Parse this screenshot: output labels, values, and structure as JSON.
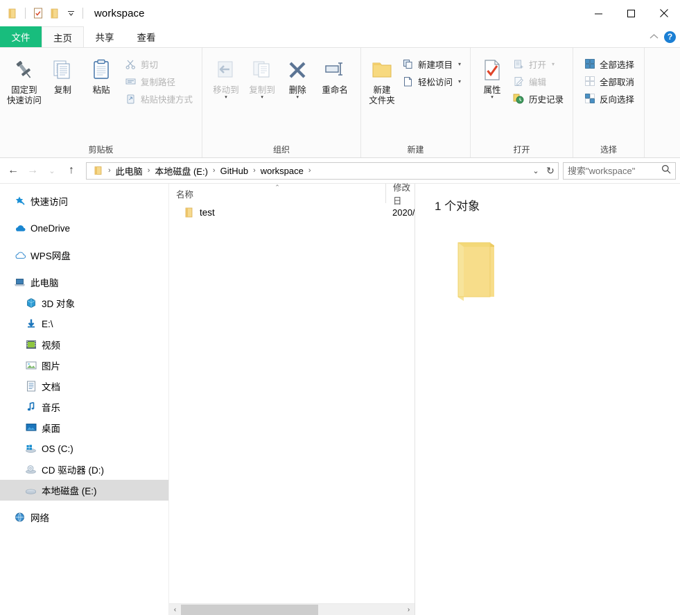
{
  "titlebar": {
    "title": "workspace",
    "qat": [
      {
        "name": "folder-icon",
        "label": "folder"
      },
      {
        "name": "properties-icon",
        "label": "属性"
      },
      {
        "name": "new-folder-icon",
        "label": "新建文件夹"
      }
    ],
    "customize_caret": "▾",
    "minimize": "—",
    "maximize": "▢",
    "close": "✕"
  },
  "tabs": [
    {
      "id": "file",
      "label": "文件"
    },
    {
      "id": "home",
      "label": "主页"
    },
    {
      "id": "share",
      "label": "共享"
    },
    {
      "id": "view",
      "label": "查看"
    }
  ],
  "tabbar_right": {
    "collapse_caret": "⌃",
    "help": "?"
  },
  "ribbon": {
    "groups": [
      {
        "id": "clipboard",
        "label": "剪贴板",
        "big": [
          {
            "name": "pin-to-quick-access-button",
            "label": "固定到\n快速访问",
            "icon": "pin-icon",
            "disabled": false
          },
          {
            "name": "copy-button",
            "label": "复制",
            "icon": "copy-icon",
            "disabled": false
          },
          {
            "name": "paste-button",
            "label": "粘贴",
            "icon": "paste-icon",
            "disabled": false
          }
        ],
        "small": [
          {
            "name": "cut-button",
            "label": "剪切",
            "icon": "scissors-icon",
            "disabled": true
          },
          {
            "name": "copy-path-button",
            "label": "复制路径",
            "icon": "copy-path-icon",
            "disabled": true
          },
          {
            "name": "paste-shortcut-button",
            "label": "粘贴快捷方式",
            "icon": "paste-shortcut-icon",
            "disabled": true
          }
        ]
      },
      {
        "id": "organize",
        "label": "组织",
        "big": [
          {
            "name": "move-to-button",
            "label": "移动到",
            "icon": "move-to-icon",
            "disabled": true,
            "caret": true
          },
          {
            "name": "copy-to-button",
            "label": "复制到",
            "icon": "copy-to-icon",
            "disabled": true,
            "caret": true
          },
          {
            "name": "delete-button",
            "label": "删除",
            "icon": "delete-x-icon",
            "disabled": false,
            "caret": true
          },
          {
            "name": "rename-button",
            "label": "重命名",
            "icon": "rename-icon",
            "disabled": false
          }
        ],
        "small": []
      },
      {
        "id": "new",
        "label": "新建",
        "big": [
          {
            "name": "new-folder-button",
            "label": "新建\n文件夹",
            "icon": "new-folder-icon",
            "disabled": false
          }
        ],
        "small": [
          {
            "name": "new-item-button",
            "label": "新建项目",
            "icon": "new-item-icon",
            "disabled": false,
            "caret": true
          },
          {
            "name": "easy-access-button",
            "label": "轻松访问",
            "icon": "easy-access-icon",
            "disabled": false,
            "caret": true
          }
        ]
      },
      {
        "id": "open",
        "label": "打开",
        "big": [
          {
            "name": "properties-button",
            "label": "属性",
            "icon": "properties-icon",
            "disabled": false,
            "caret": true
          }
        ],
        "small": [
          {
            "name": "open-button",
            "label": "打开",
            "icon": "open-icon",
            "disabled": true,
            "caret": true
          },
          {
            "name": "edit-button",
            "label": "编辑",
            "icon": "edit-icon",
            "disabled": true
          },
          {
            "name": "history-button",
            "label": "历史记录",
            "icon": "history-icon",
            "disabled": false
          }
        ]
      },
      {
        "id": "select",
        "label": "选择",
        "big": [],
        "small": [
          {
            "name": "select-all-button",
            "label": "全部选择",
            "icon": "select-all-icon",
            "disabled": false
          },
          {
            "name": "select-none-button",
            "label": "全部取消",
            "icon": "select-none-icon",
            "disabled": false
          },
          {
            "name": "invert-selection-button",
            "label": "反向选择",
            "icon": "invert-selection-icon",
            "disabled": false
          }
        ]
      }
    ]
  },
  "addressbar": {
    "back": "←",
    "forward": "→",
    "recent_caret": "⌄",
    "up": "↑",
    "crumbs": [
      "此电脑",
      "本地磁盘 (E:)",
      "GitHub",
      "workspace"
    ],
    "sep": "›",
    "history_caret": "⌄",
    "refresh": "↻",
    "search_placeholder": "搜索\"workspace\"",
    "search_value": ""
  },
  "sidebar": {
    "items": [
      {
        "label": "快速访问",
        "icon": "star-pin-icon",
        "indent": false,
        "selected": false,
        "gap_after": true
      },
      {
        "label": "OneDrive",
        "icon": "onedrive-cloud-icon",
        "indent": false,
        "selected": false,
        "gap_after": true
      },
      {
        "label": "WPS网盘",
        "icon": "wps-cloud-icon",
        "indent": false,
        "selected": false,
        "gap_after": true
      },
      {
        "label": "此电脑",
        "icon": "this-pc-icon",
        "indent": false,
        "selected": false,
        "gap_after": false
      },
      {
        "label": "3D 对象",
        "icon": "3d-objects-icon",
        "indent": true,
        "selected": false,
        "gap_after": false
      },
      {
        "label": "E:\\",
        "icon": "downloads-icon",
        "indent": true,
        "selected": false,
        "gap_after": false
      },
      {
        "label": "视频",
        "icon": "videos-icon",
        "indent": true,
        "selected": false,
        "gap_after": false
      },
      {
        "label": "图片",
        "icon": "pictures-icon",
        "indent": true,
        "selected": false,
        "gap_after": false
      },
      {
        "label": "文档",
        "icon": "documents-icon",
        "indent": true,
        "selected": false,
        "gap_after": false
      },
      {
        "label": "音乐",
        "icon": "music-icon",
        "indent": true,
        "selected": false,
        "gap_after": false
      },
      {
        "label": "桌面",
        "icon": "desktop-icon",
        "indent": true,
        "selected": false,
        "gap_after": false
      },
      {
        "label": "OS (C:)",
        "icon": "windows-drive-icon",
        "indent": true,
        "selected": false,
        "gap_after": false
      },
      {
        "label": "CD 驱动器 (D:)",
        "icon": "cd-drive-icon",
        "indent": true,
        "selected": false,
        "gap_after": false
      },
      {
        "label": "本地磁盘 (E:)",
        "icon": "hard-drive-icon",
        "indent": true,
        "selected": true,
        "gap_after": true
      },
      {
        "label": "网络",
        "icon": "network-icon",
        "indent": false,
        "selected": false,
        "gap_after": false
      }
    ]
  },
  "filelist": {
    "columns": [
      {
        "id": "name",
        "label": "名称",
        "sorted": true,
        "sort_caret": "⌃"
      },
      {
        "id": "date",
        "label": "修改日",
        "sorted": false,
        "sort_caret": ""
      }
    ],
    "rows": [
      {
        "name": "test",
        "date": "2020/",
        "icon": "folder-icon"
      }
    ],
    "hscroll": {
      "left_arrow": "‹",
      "right_arrow": "›"
    }
  },
  "preview": {
    "count_text": "1 个对象",
    "icon": "large-folder-icon"
  },
  "colors": {
    "file_tab_green": "#18bd7d",
    "selection_blue": "#e5f3fb",
    "selected_gray": "#dcdcdc",
    "folder_yellow": "#f5d27a",
    "accent_blue": "#1b7fd4"
  }
}
